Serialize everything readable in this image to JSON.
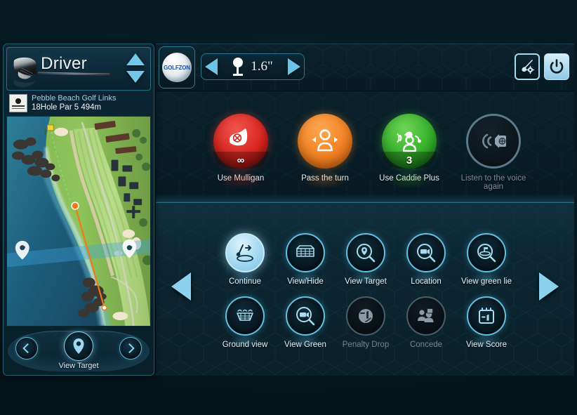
{
  "app": {
    "brand": "GOLFZON",
    "accent_blue": "#63c0e2",
    "panel_bg": "#0a2029"
  },
  "club_selector": {
    "name": "Driver",
    "icon": "driver-club-icon",
    "up_icon": "chevron-up-icon",
    "down_icon": "chevron-down-icon"
  },
  "course": {
    "name": "Pebble Beach Golf Links",
    "hole_info": "18Hole Par 5 494m",
    "logo_icon": "pebble-beach-logo"
  },
  "map": {
    "view_icon": "aerial-course-map"
  },
  "target_control": {
    "label": "View Target",
    "prev_icon": "chevron-left-icon",
    "center_icon": "location-pin-icon",
    "next_icon": "chevron-right-icon"
  },
  "top_bar": {
    "logo_label": "GOLFZON",
    "tee_height": "1.6\"",
    "tee_icon": "golf-tee-icon",
    "tee_prev_icon": "triangle-left-icon",
    "tee_next_icon": "triangle-right-icon",
    "club_setting_icon": "club-settings-icon",
    "power_icon": "power-icon"
  },
  "actions": [
    {
      "label": "Use Mulligan",
      "icon": "mulligan-club-icon",
      "badge": "∞",
      "color": "#d8251f",
      "state": "enabled"
    },
    {
      "label": "Pass the turn",
      "icon": "pass-turn-person-icon",
      "badge": "",
      "color": "#f08022",
      "state": "enabled"
    },
    {
      "label": "Use Caddie Plus",
      "icon": "caddie-plus-icon",
      "badge": "3",
      "color": "#34af2b",
      "state": "enabled"
    },
    {
      "label": "Listen to the voice again",
      "icon": "voice-replay-icon",
      "badge": "",
      "color": "#5b7b8c",
      "state": "disabled"
    }
  ],
  "grid_buttons": [
    {
      "label": "Continue",
      "icon": "continue-swing-icon",
      "state": "active"
    },
    {
      "label": "View/Hide",
      "icon": "grid-overlay-icon",
      "state": "enabled"
    },
    {
      "label": "View Target",
      "icon": "target-pin-zoom-icon",
      "state": "enabled"
    },
    {
      "label": "Location",
      "icon": "camera-zoom-icon",
      "state": "enabled"
    },
    {
      "label": "View green lie",
      "icon": "green-lie-zoom-icon",
      "state": "enabled"
    },
    {
      "label": "Ground view",
      "icon": "ground-view-icon",
      "state": "enabled"
    },
    {
      "label": "View Green",
      "icon": "camera-zoom-icon",
      "state": "enabled"
    },
    {
      "label": "Penalty Drop",
      "icon": "penalty-minus-one-icon",
      "state": "disabled"
    },
    {
      "label": "Concede",
      "icon": "concede-players-icon",
      "state": "disabled"
    },
    {
      "label": "View Score",
      "icon": "scorecard-minus-one-icon",
      "state": "enabled"
    }
  ],
  "pagination": {
    "prev_icon": "page-prev-arrow",
    "next_icon": "page-next-arrow"
  }
}
